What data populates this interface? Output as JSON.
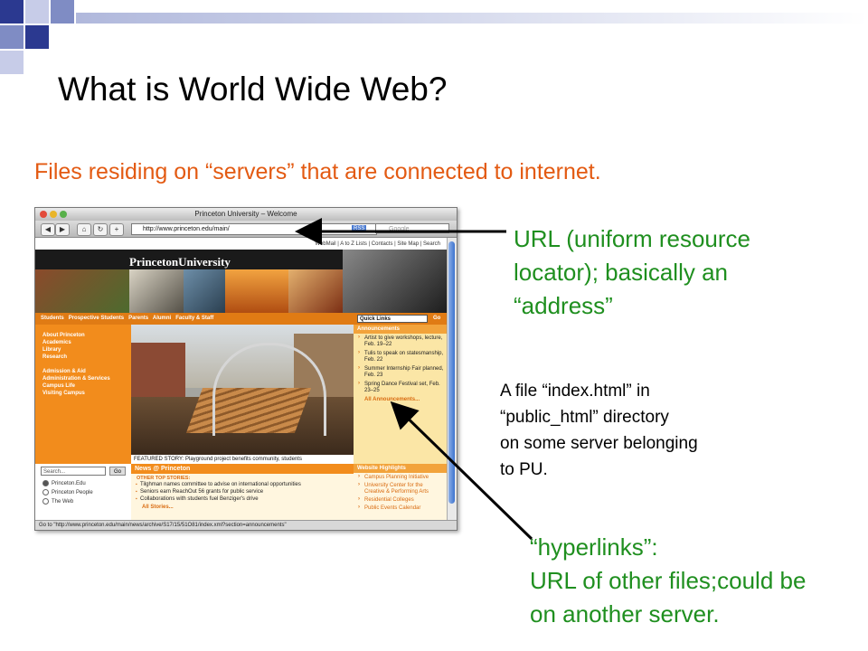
{
  "colors": {
    "title": "#000000",
    "subtitle": "#e35a12",
    "green_note": "#1f8f1f",
    "deco_dark": "#2b3990",
    "deco_mid": "#7f8cc4",
    "deco_light": "#c7cce8",
    "princeton_orange": "#f28c1c"
  },
  "slide": {
    "title": "What is World Wide Web?",
    "subtitle": "Files residing on “servers” that are connected to internet."
  },
  "notes": {
    "url": [
      "URL (uniform resource",
      "locator); basically an",
      "“address”"
    ],
    "file": [
      "A file “index.html” in",
      "“public_html” directory",
      "on some server belonging",
      "to PU."
    ],
    "hyperlinks": [
      "“hyperlinks”:",
      "URL of other files;could be",
      "on another server."
    ]
  },
  "browser": {
    "window_title": "Princeton University – Welcome",
    "back_icon": "back-arrow-icon",
    "forward_icon": "forward-arrow-icon",
    "home_icon": "home-icon",
    "reload_icon": "reload-icon",
    "add_icon": "plus-icon",
    "url": "http://www.princeton.edu/main/",
    "rss": "RSS",
    "search_placeholder": "Google",
    "status": "Go to \"http://www.princeton.edu/main/news/archive/S17/15/51O81/index.xml?section=announcements\""
  },
  "site": {
    "top_links": [
      "WebMail",
      "A to Z Lists",
      "Contacts",
      "Site Map",
      "Search"
    ],
    "logo": "PrincetonUniversity",
    "nav": [
      "Students",
      "Prospective Students",
      "Parents",
      "Alumni",
      "Faculty & Staff"
    ],
    "quick_links": "Quick Links",
    "go": "Go",
    "left_nav_1": [
      "About Princeton",
      "Academics",
      "Library",
      "Research"
    ],
    "left_nav_2": [
      "Admission & Aid",
      "Administration & Services",
      "Campus Life",
      "Visiting Campus"
    ],
    "featured_caption": "FEATURED STORY: Playground project benefits community, students",
    "announcements_title": "Announcements",
    "announcements": [
      "Artist to give workshops, lecture, Feb. 19–22",
      "Tulis to speak on statesmanship, Feb. 22",
      "Summer Internship Fair planned, Feb. 23",
      "Spring Dance Festival set, Feb. 23–25"
    ],
    "announcements_more": "All Announcements...",
    "search_placeholder": "Search...",
    "search_go": "Go",
    "search_options": [
      "Princeton.Edu",
      "Princeton People",
      "The Web"
    ],
    "news_title": "News @ Princeton",
    "other_stories": "OTHER TOP STORIES:",
    "news_items": [
      "Tilghman names committee to advise on international opportunities",
      "Seniors earn ReachOut 56 grants for public service",
      "Collaborations with students fuel Benziger's drive"
    ],
    "news_more": "All Stories...",
    "highlights_title": "Website Highlights",
    "highlights": [
      "Campus Planning Initiative",
      "University Center for the Creative & Performing Arts",
      "Residential Colleges",
      "Public Events Calendar"
    ]
  }
}
